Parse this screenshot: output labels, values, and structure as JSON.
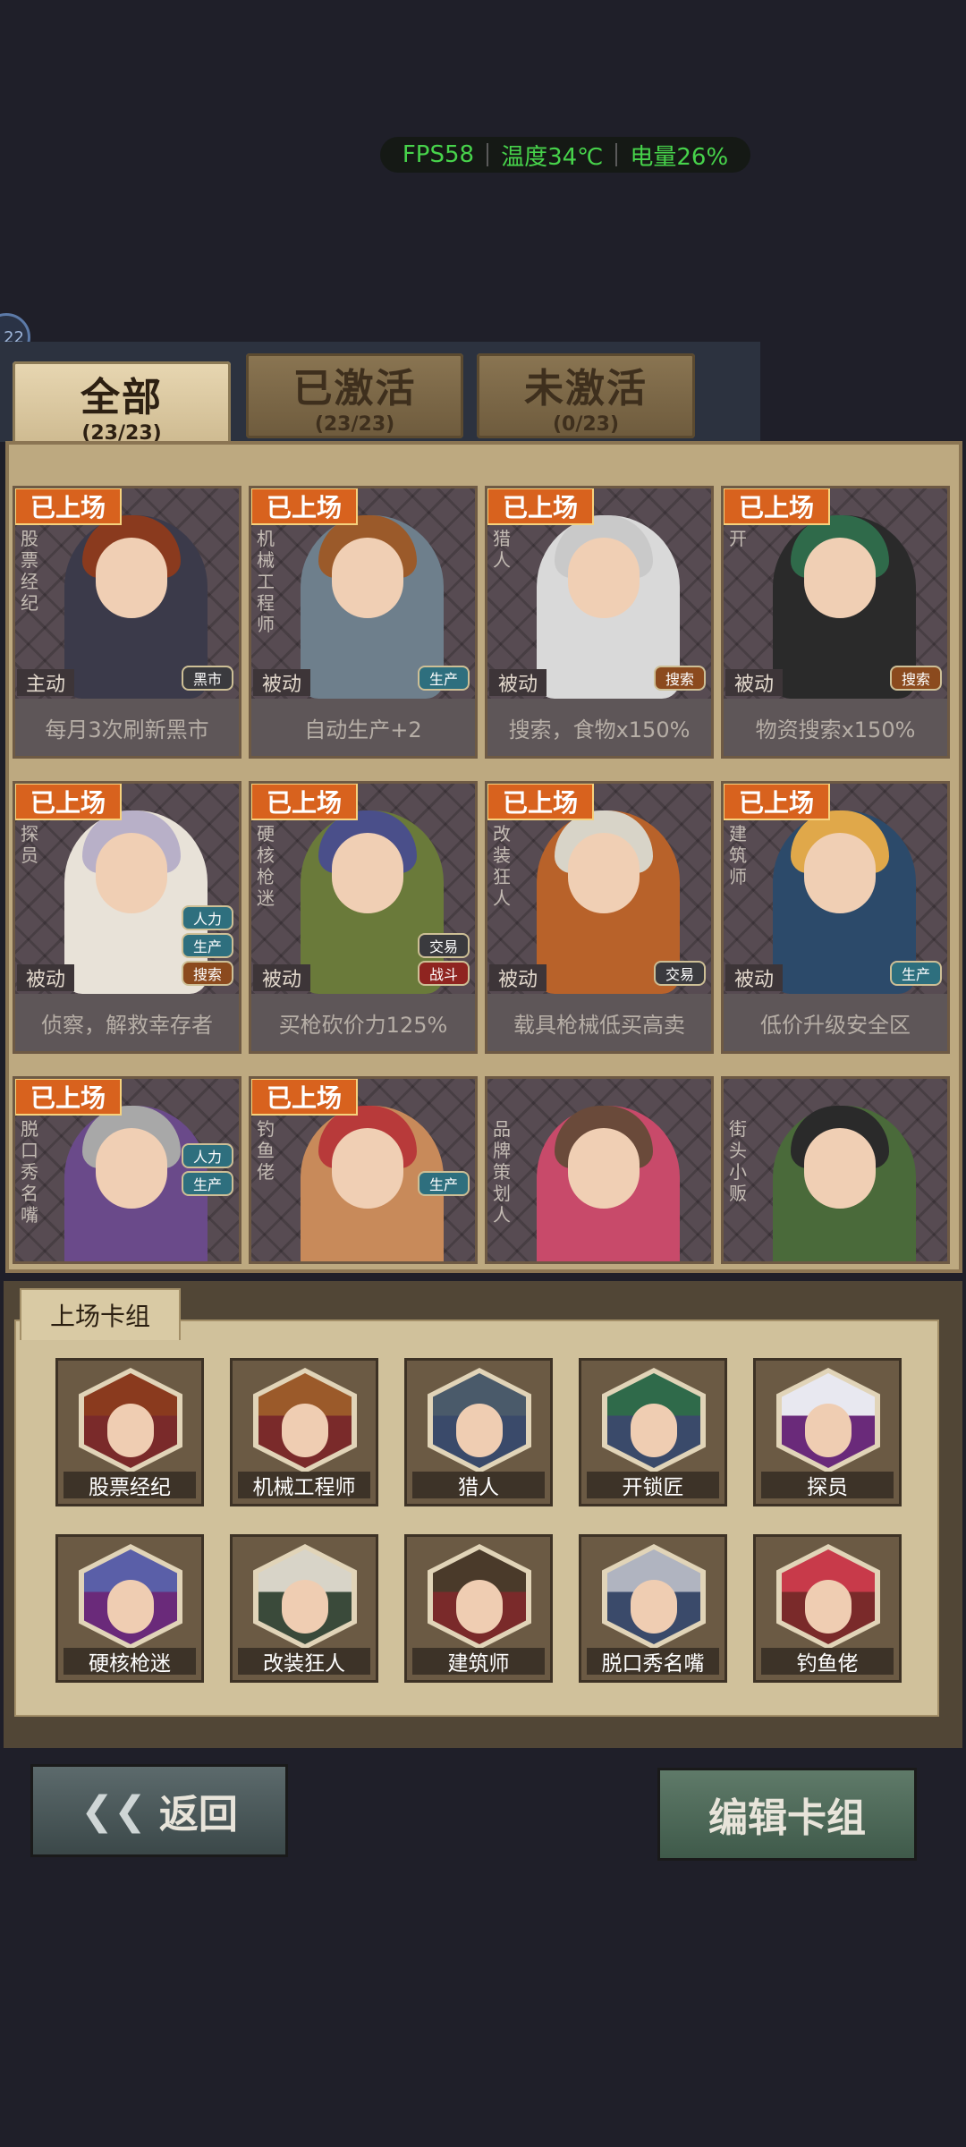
{
  "status_overlay": {
    "fps": "FPS58",
    "temperature": "温度34℃",
    "battery": "电量26%"
  },
  "side_bubble_text": "22",
  "tabs": [
    {
      "title": "全部",
      "count": "(23/23)"
    },
    {
      "title": "已激活",
      "count": "(23/23)"
    },
    {
      "title": "未激活",
      "count": "(0/23)"
    }
  ],
  "cards": [
    {
      "badge": "已上场",
      "vertical_name": "股票经纪",
      "mode": "主动",
      "desc": "每月3次刷新黑市",
      "tags": [
        "黑市"
      ],
      "hair": "#8a3a1e",
      "outfit": "#3b3a4a"
    },
    {
      "badge": "已上场",
      "vertical_name": "机械工程师",
      "mode": "被动",
      "desc": "自动生产+2",
      "tags": [
        "生产"
      ],
      "hair": "#9b5a2a",
      "outfit": "#6e7f8c"
    },
    {
      "badge": "已上场",
      "vertical_name": "猎人",
      "mode": "被动",
      "desc": "搜索，食物x150%",
      "tags": [
        "搜索"
      ],
      "hair": "#c9c9c9",
      "outfit": "#d9d9d9"
    },
    {
      "badge": "已上场",
      "vertical_name": "开",
      "mode": "被动",
      "desc": "物资搜索x150%",
      "tags": [
        "搜索"
      ],
      "hair": "#2f6a4a",
      "outfit": "#2a2a2a"
    },
    {
      "badge": "已上场",
      "vertical_name": "探员",
      "mode": "被动",
      "desc": "侦察，解救幸存者",
      "tags": [
        "人力",
        "生产",
        "搜索"
      ],
      "hair": "#b8b0c8",
      "outfit": "#e8e2d8"
    },
    {
      "badge": "已上场",
      "vertical_name": "硬核枪迷",
      "mode": "被动",
      "desc": "买枪砍价力125%",
      "tags": [
        "交易",
        "战斗"
      ],
      "hair": "#4a4f8a",
      "outfit": "#6a7a3a"
    },
    {
      "badge": "已上场",
      "vertical_name": "改装狂人",
      "mode": "被动",
      "desc": "载具枪械低买高卖",
      "tags": [
        "交易"
      ],
      "hair": "#d8d4c8",
      "outfit": "#b8622a"
    },
    {
      "badge": "已上场",
      "vertical_name": "建筑师",
      "mode": "被动",
      "desc": "低价升级安全区",
      "tags": [
        "生产"
      ],
      "hair": "#e0a84a",
      "outfit": "#2c4a6a"
    },
    {
      "badge": "已上场",
      "vertical_name": "脱口秀名嘴",
      "mode": "",
      "desc": "",
      "tags": [
        "人力",
        "生产"
      ],
      "hair": "#a8a8a8",
      "outfit": "#6a4a8a"
    },
    {
      "badge": "已上场",
      "vertical_name": "钓鱼佬",
      "mode": "",
      "desc": "",
      "tags": [
        "生产"
      ],
      "hair": "#b83a3a",
      "outfit": "#c88a5a"
    },
    {
      "badge": "",
      "vertical_name": "品牌策划人",
      "mode": "",
      "desc": "",
      "tags": [],
      "hair": "#6a4a3a",
      "outfit": "#c84a6a"
    },
    {
      "badge": "",
      "vertical_name": "街头小贩",
      "mode": "",
      "desc": "",
      "tags": [],
      "hair": "#2a2a2a",
      "outfit": "#4a6a3a"
    }
  ],
  "deck": {
    "title": "上场卡组",
    "members": [
      {
        "name": "股票经纪",
        "bg": "#7a2a2a",
        "hair": "#8a3a1e"
      },
      {
        "name": "机械工程师",
        "bg": "#7a2a2a",
        "hair": "#9b5a2a"
      },
      {
        "name": "猎人",
        "bg": "#3a4a6a",
        "hair": "#4a5a6a"
      },
      {
        "name": "开锁匠",
        "bg": "#3a4a6a",
        "hair": "#2f6a4a"
      },
      {
        "name": "探员",
        "bg": "#6a2a7a",
        "hair": "#e8e8f0"
      },
      {
        "name": "硬核枪迷",
        "bg": "#6a2a7a",
        "hair": "#5a5fa8"
      },
      {
        "name": "改装狂人",
        "bg": "#3a4a3a",
        "hair": "#d8d4c8"
      },
      {
        "name": "建筑师",
        "bg": "#7a2a2a",
        "hair": "#4a3a2a"
      },
      {
        "name": "脱口秀名嘴",
        "bg": "#3a4a6a",
        "hair": "#b0b4c0"
      },
      {
        "name": "钓鱼佬",
        "bg": "#7a2a2a",
        "hair": "#c83a4a"
      }
    ]
  },
  "buttons": {
    "back": "返回",
    "edit_deck": "编辑卡组"
  }
}
